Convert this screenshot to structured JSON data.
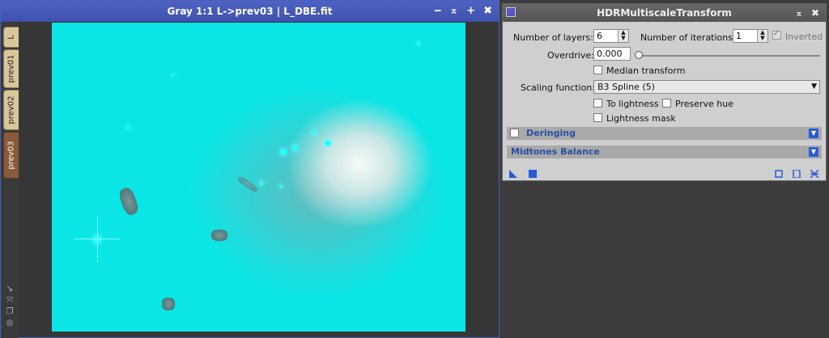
{
  "image_window": {
    "title": "Gray 1:1 L->prev03 | L_DBE.fit",
    "controls": [
      "‒",
      "⌅",
      "+",
      "✖"
    ],
    "tabs": [
      {
        "label": "L",
        "active": false
      },
      {
        "label": "prev01",
        "active": false
      },
      {
        "label": "prev02",
        "active": false
      },
      {
        "label": "prev03",
        "active": true
      }
    ]
  },
  "process": {
    "title": "HDRMultiscaleTransform",
    "layers_label": "Number of layers:",
    "layers_value": "6",
    "iterations_label": "Number of iterations:",
    "iterations_value": "1",
    "inverted_label": "Inverted",
    "inverted_checked": true,
    "overdrive_label": "Overdrive:",
    "overdrive_value": "0.000",
    "median_label": "Median transform",
    "scaling_label": "Scaling function:",
    "scaling_value": "B3 Spline (5)",
    "to_lightness_label": "To lightness",
    "preserve_hue_label": "Preserve hue",
    "lightness_mask_label": "Lightness mask",
    "deringing_label": "Deringing",
    "midtones_label": "Midtones Balance"
  },
  "colors": {
    "accent": "#3e51ad",
    "image_bg": "#0ae6e6",
    "section_text": "#2a4ea6"
  }
}
